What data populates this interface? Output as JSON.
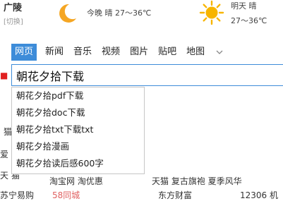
{
  "weather": {
    "city": "广陵",
    "switch_label": "[切换]",
    "tonight": "今晚  晴   27～36℃",
    "tomorrow": "明天  晴",
    "tomorrow_temp": "27～36℃"
  },
  "search_tabs": [
    {
      "label": "网页",
      "active": true
    },
    {
      "label": "新闻",
      "active": false
    },
    {
      "label": "音乐",
      "active": false
    },
    {
      "label": "视频",
      "active": false
    },
    {
      "label": "图片",
      "active": false
    },
    {
      "label": "贴吧",
      "active": false
    },
    {
      "label": "地图",
      "active": false
    }
  ],
  "search": {
    "query": "朝花夕拾下载"
  },
  "suggestions": [
    "朝花夕拾pdf下载",
    "朝花夕拾doc下载",
    "朝花夕拾txt下载txt",
    "朝花夕拾漫画",
    "朝花夕拾读后感600字"
  ],
  "background": {
    "left_1": "猫",
    "left_2": "爱",
    "left_3": "天  猫",
    "row_3_mid": "淘宝网    淘优惠",
    "row_3_right": "天猫    复古旗袍    夏季风华",
    "row_4_left": "苏宁易购",
    "row_4_mid": "58同城",
    "row_4_mid2": "东方财富",
    "row_4_right": "12306   机"
  },
  "colors": {
    "accent": "#3d8cd9",
    "weather_moon": "#f5a623",
    "weather_sun": "#f7b500"
  }
}
